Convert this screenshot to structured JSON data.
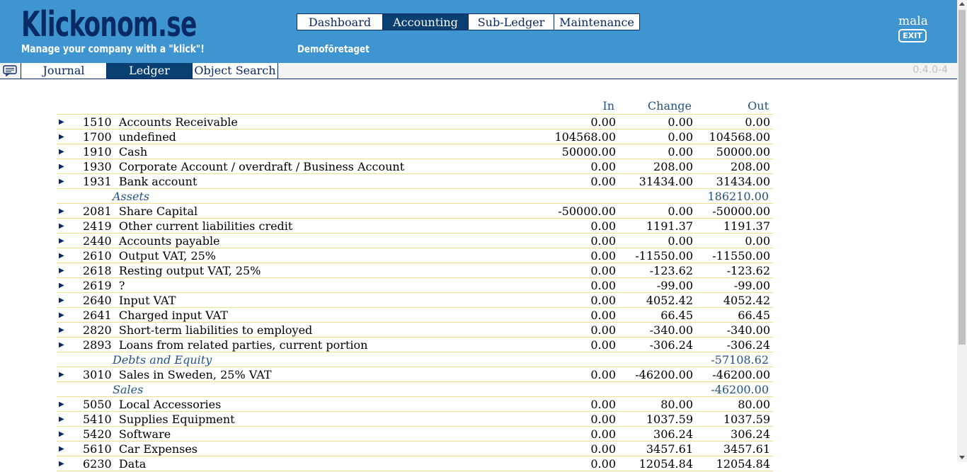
{
  "header": {
    "logo": "Klickonom.se",
    "tagline": "Manage your company with a \"klick\"!",
    "company": "Demoföretaget",
    "user": "mala",
    "exit_label": "EXIT",
    "tabs": [
      {
        "label": "Dashboard",
        "active": false
      },
      {
        "label": "Accounting",
        "active": true
      },
      {
        "label": "Sub-Ledger",
        "active": false
      },
      {
        "label": "Maintenance",
        "active": false
      }
    ]
  },
  "subnav": {
    "tabs": [
      {
        "label": "Journal",
        "active": false
      },
      {
        "label": "Ledger",
        "active": true
      },
      {
        "label": "Object Search",
        "active": false
      }
    ],
    "version": "0.4.0-4"
  },
  "ledger": {
    "columns": {
      "in": "In",
      "change": "Change",
      "out": "Out"
    },
    "rows": [
      {
        "type": "account",
        "account": "1510",
        "name": "Accounts Receivable",
        "in": "0.00",
        "change": "0.00",
        "out": "0.00"
      },
      {
        "type": "account",
        "account": "1700",
        "name": "undefined",
        "in": "104568.00",
        "change": "0.00",
        "out": "104568.00"
      },
      {
        "type": "account",
        "account": "1910",
        "name": "Cash",
        "in": "50000.00",
        "change": "0.00",
        "out": "50000.00"
      },
      {
        "type": "account",
        "account": "1930",
        "name": "Corporate Account / overdraft / Business Account",
        "in": "0.00",
        "change": "208.00",
        "out": "208.00"
      },
      {
        "type": "account",
        "account": "1931",
        "name": "Bank account",
        "in": "0.00",
        "change": "31434.00",
        "out": "31434.00"
      },
      {
        "type": "group",
        "name": "Assets",
        "total": "186210.00"
      },
      {
        "type": "account",
        "account": "2081",
        "name": "Share Capital",
        "in": "-50000.00",
        "change": "0.00",
        "out": "-50000.00"
      },
      {
        "type": "account",
        "account": "2419",
        "name": "Other current liabilities credit",
        "in": "0.00",
        "change": "1191.37",
        "out": "1191.37"
      },
      {
        "type": "account",
        "account": "2440",
        "name": "Accounts payable",
        "in": "0.00",
        "change": "0.00",
        "out": "0.00"
      },
      {
        "type": "account",
        "account": "2610",
        "name": "Output VAT, 25%",
        "in": "0.00",
        "change": "-11550.00",
        "out": "-11550.00"
      },
      {
        "type": "account",
        "account": "2618",
        "name": "Resting output VAT, 25%",
        "in": "0.00",
        "change": "-123.62",
        "out": "-123.62"
      },
      {
        "type": "account",
        "account": "2619",
        "name": "?",
        "in": "0.00",
        "change": "-99.00",
        "out": "-99.00"
      },
      {
        "type": "account",
        "account": "2640",
        "name": "Input VAT",
        "in": "0.00",
        "change": "4052.42",
        "out": "4052.42"
      },
      {
        "type": "account",
        "account": "2641",
        "name": "Charged input VAT",
        "in": "0.00",
        "change": "66.45",
        "out": "66.45"
      },
      {
        "type": "account",
        "account": "2820",
        "name": "Short-term liabilities to employed",
        "in": "0.00",
        "change": "-340.00",
        "out": "-340.00"
      },
      {
        "type": "account",
        "account": "2893",
        "name": "Loans from related parties, current portion",
        "in": "0.00",
        "change": "-306.24",
        "out": "-306.24"
      },
      {
        "type": "group",
        "name": "Debts and Equity",
        "total": "-57108.62"
      },
      {
        "type": "account",
        "account": "3010",
        "name": "Sales in Sweden, 25% VAT",
        "in": "0.00",
        "change": "-46200.00",
        "out": "-46200.00"
      },
      {
        "type": "group",
        "name": "Sales",
        "total": "-46200.00"
      },
      {
        "type": "account",
        "account": "5050",
        "name": "Local Accessories",
        "in": "0.00",
        "change": "80.00",
        "out": "80.00"
      },
      {
        "type": "account",
        "account": "5410",
        "name": "Supplies Equipment",
        "in": "0.00",
        "change": "1037.59",
        "out": "1037.59"
      },
      {
        "type": "account",
        "account": "5420",
        "name": "Software",
        "in": "0.00",
        "change": "306.24",
        "out": "306.24"
      },
      {
        "type": "account",
        "account": "5610",
        "name": "Car Expenses",
        "in": "0.00",
        "change": "3457.61",
        "out": "3457.61"
      },
      {
        "type": "account",
        "account": "6230",
        "name": "Data",
        "in": "0.00",
        "change": "12054.84",
        "out": "12054.84"
      }
    ]
  }
}
